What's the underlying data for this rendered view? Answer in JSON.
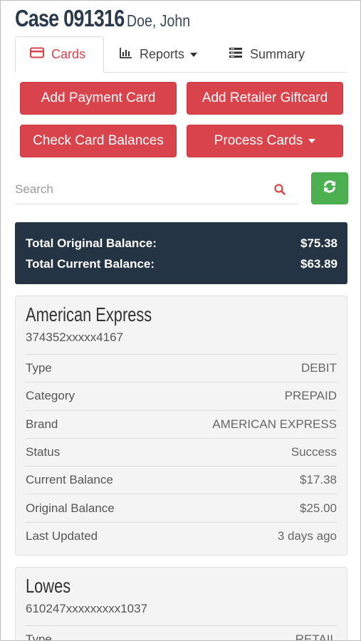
{
  "header": {
    "case_title": "Case 091316",
    "client_name": "Doe, John"
  },
  "tabs": [
    {
      "label": "Cards",
      "icon": "credit-card-icon",
      "active": true
    },
    {
      "label": "Reports",
      "icon": "bar-chart-icon",
      "active": false
    },
    {
      "label": "Summary",
      "icon": "list-icon",
      "active": false
    }
  ],
  "actions": {
    "add_payment": "Add Payment Card",
    "add_retailer": "Add Retailer Giftcard",
    "check_balances": "Check Card Balances",
    "process_cards": "Process Cards"
  },
  "search": {
    "placeholder": "Search",
    "value": ""
  },
  "totals": {
    "original_label": "Total Original Balance:",
    "original_value": "$75.38",
    "current_label": "Total Current Balance:",
    "current_value": "$63.89"
  },
  "cards": [
    {
      "name": "American Express",
      "number": "374352xxxxx4167",
      "details": [
        {
          "key": "Type",
          "value": "DEBIT"
        },
        {
          "key": "Category",
          "value": "PREPAID"
        },
        {
          "key": "Brand",
          "value": "AMERICAN EXPRESS"
        },
        {
          "key": "Status",
          "value": "Success"
        },
        {
          "key": "Current Balance",
          "value": "$17.38"
        },
        {
          "key": "Original Balance",
          "value": "$25.00"
        },
        {
          "key": "Last Updated",
          "value": "3 days ago"
        }
      ]
    },
    {
      "name": "Lowes",
      "number": "610247xxxxxxxxx1037",
      "details": [
        {
          "key": "Type",
          "value": "RETAIL"
        }
      ]
    }
  ],
  "colors": {
    "accent": "#d9434b",
    "refresh": "#4caf50",
    "totals_bg": "#243444",
    "panel_bg": "#f4f4f4"
  }
}
